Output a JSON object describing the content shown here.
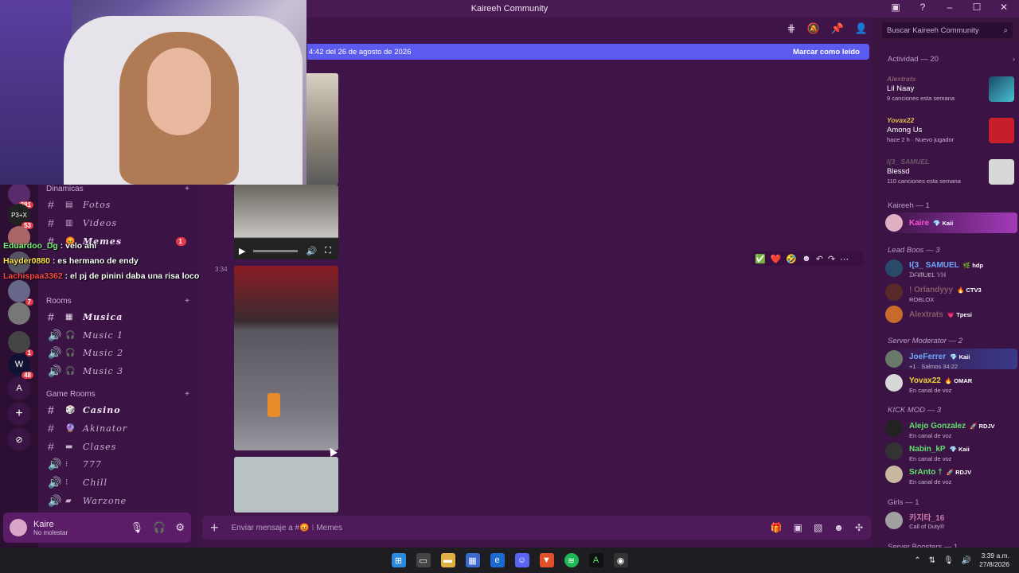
{
  "window": {
    "title": "Kaireeh Community",
    "controls": [
      "–",
      "☐",
      "✕"
    ]
  },
  "header": {
    "icons": [
      "threads-icon",
      "mute-icon",
      "pin-icon",
      "members-icon"
    ]
  },
  "search": {
    "placeholder": "Buscar Kaireeh Community",
    "icon": "🔍"
  },
  "newbar": {
    "text": "4:42 del 26 de agosto de 2026",
    "mark": "Marcar como leído"
  },
  "servers": [
    {
      "label": "",
      "badge": "381"
    },
    {
      "label": "P3+X",
      "badge": "53"
    },
    {
      "label": "",
      "badge": ""
    },
    {
      "label": "",
      "badge": ""
    },
    {
      "label": "",
      "badge": "7"
    },
    {
      "label": "",
      "badge": ""
    },
    {
      "label": "",
      "badge": "1"
    },
    {
      "label": "W",
      "badge": "48"
    },
    {
      "label": "A",
      "badge": ""
    },
    {
      "label": "+",
      "badge": ""
    },
    {
      "label": "⊘",
      "badge": ""
    }
  ],
  "categories": {
    "dinamicas": "Dinamicas",
    "rooms": "Rooms",
    "gamerooms": "Game Rooms"
  },
  "channels": {
    "fotos": "Fotos",
    "videos": "Videos",
    "memes": "Memes",
    "memes_badge": "1",
    "musica": "Musica",
    "music1": "Music 1",
    "music2": "Music 2",
    "music3": "Music 3",
    "casino": "Casino",
    "akinator": "Akinator",
    "clases": "Clases",
    "c777": "777",
    "chill": "Chill",
    "warzone": "Warzone"
  },
  "overlay_chat": [
    {
      "user": "Eduardoo_Dg",
      "text": ": velo ahi"
    },
    {
      "user": "Hayder0880",
      "text": ": es hermano de endy"
    },
    {
      "user": "Lachispaa3362",
      "text": ": el pj de pinini daba una risa loco"
    }
  ],
  "message": {
    "timestamp": "3:34"
  },
  "reactions": [
    "✅",
    "❤️",
    "🤣",
    "☻",
    "↶",
    "↷",
    "⋯"
  ],
  "composer": {
    "placeholder": "Enviar mensaje a #😡 ⁝ Memes"
  },
  "userpanel": {
    "name": "Kaire",
    "status": "No molestar"
  },
  "members": {
    "activity_title": "Actividad — 20",
    "activities": [
      {
        "name": "Alextrats",
        "title": "Lil Naay",
        "detail": "9 canciones esta semana"
      },
      {
        "name": "Yovax22",
        "title": "Among Us",
        "detail": "hace 2 h  · Nuevo jugador"
      },
      {
        "name": "I{3_ SAMUEL",
        "title": "Blessd",
        "detail": "110 canciones esta semana"
      }
    ],
    "groups": {
      "kaireeh": "Kaireeh — 1",
      "leadboos": "Lead Boos — 3",
      "servermod": "Server Moderator — 2",
      "kickmod": "KICK MOD — 3",
      "girls": "Girls — 1",
      "boosters": "Server Boosters — 1"
    },
    "list": [
      {
        "name": "Kaire",
        "tag": "💎 Kaii",
        "sub": "",
        "color": "#ff4fd8"
      },
      {
        "name": "I{3_ SAMUEL",
        "tag": "🌿 hdp",
        "sub": "ᗪᗩᗰᑌEᒪ 𝕐ℍ",
        "color": "#6fa8ff"
      },
      {
        "name": "! Orlandyyy",
        "tag": "🔥 CTV3",
        "sub": "ROBLOX",
        "color": "#8a5a6a"
      },
      {
        "name": "Alextrats",
        "tag": "💗 Tpesi",
        "sub": "",
        "color": "#8a5a6a"
      },
      {
        "name": "JoeFerrer",
        "tag": "💎 Kaii",
        "sub": "+1 · Salmos 34:22",
        "color": "#6fa8ff"
      },
      {
        "name": "Yovax22",
        "tag": "🔥 OMAR",
        "sub": "En canal de voz",
        "color": "#f2d23a"
      },
      {
        "name": "Alejo Gonzalez",
        "tag": "🚀 RDJV",
        "sub": "En canal de voz",
        "color": "#5fe06a"
      },
      {
        "name": "Nabin_kP",
        "tag": "💎 Kaii",
        "sub": "En canal de voz",
        "color": "#5fe06a"
      },
      {
        "name": "SrAnto †",
        "tag": "🚀 RDJV",
        "sub": "En canal de voz",
        "color": "#5fe06a"
      },
      {
        "name": "카지타_16",
        "tag": "",
        "sub": "Call of Duty®",
        "color": "#c97aa8"
      }
    ]
  },
  "taskbar": {
    "clock_time": "3:39 a.m.",
    "clock_date": "27/8/2026"
  }
}
